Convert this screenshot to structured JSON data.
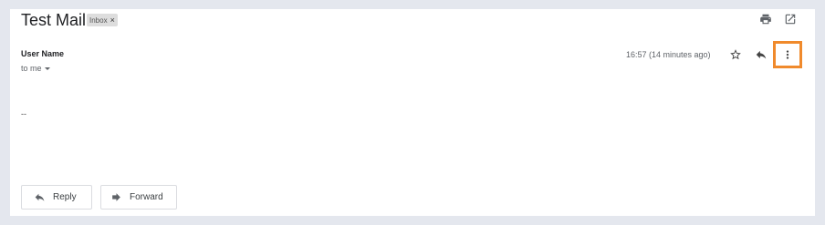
{
  "message": {
    "subject": "Test Mail",
    "label": "Inbox",
    "label_remove": "×",
    "sender": "User Name",
    "recipient": "to me",
    "timestamp": "16:57 (14 minutes ago)",
    "body": "--"
  },
  "toolbar_icons": [
    "print-icon",
    "open-in-new-window-icon"
  ],
  "action_icons": [
    "star-icon",
    "reply-icon",
    "more-vert-icon"
  ],
  "footer": {
    "reply_label": "Reply",
    "forward_label": "Forward"
  },
  "colors": {
    "highlight": "#f08a2c",
    "background": "#e4e7ee",
    "label_chip": "#dddddd"
  }
}
